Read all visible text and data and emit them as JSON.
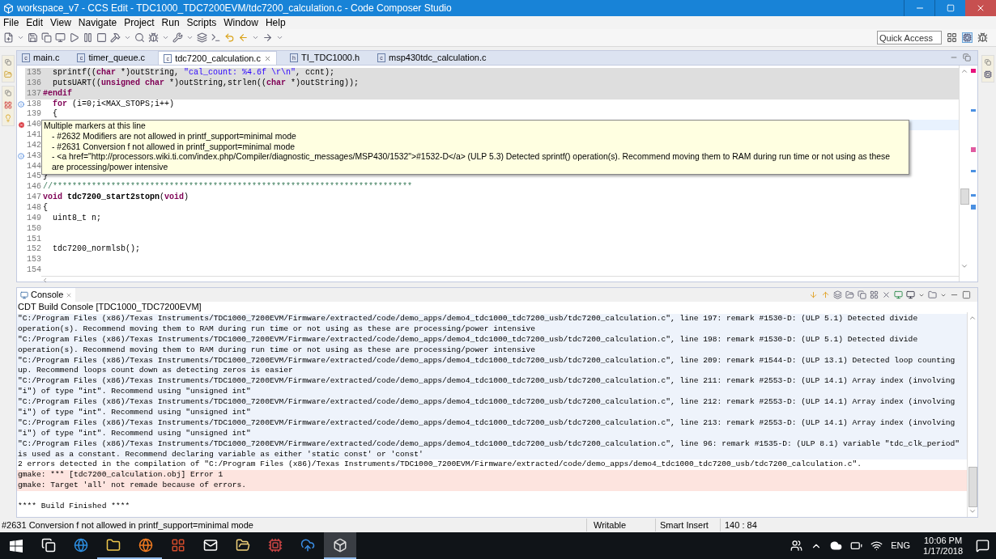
{
  "window": {
    "title": "workspace_v7 - CCS Edit - TDC1000_TDC7200EVM/tdc7200_calculation.c - Code Composer Studio"
  },
  "menu": [
    "File",
    "Edit",
    "View",
    "Navigate",
    "Project",
    "Run",
    "Scripts",
    "Window",
    "Help"
  ],
  "quick_access": {
    "placeholder": "Quick Access"
  },
  "editor_tabs": [
    {
      "label": "main.c",
      "type": "c",
      "selected": false
    },
    {
      "label": "timer_queue.c",
      "type": "c",
      "selected": false
    },
    {
      "label": "tdc7200_calculation.c",
      "type": "c",
      "selected": true
    },
    {
      "label": "TI_TDC1000.h",
      "type": "h",
      "selected": false
    },
    {
      "label": "msp430tdc_calculation.c",
      "type": "c",
      "selected": false
    }
  ],
  "editor": {
    "lines": [
      {
        "number": "135",
        "kind": "plain",
        "inactive": true,
        "current": false,
        "tokens": [
          {
            "kind": "plain",
            "text": "  sprintf(("
          },
          {
            "kind": "keyword",
            "text": "char"
          },
          {
            "kind": "plain",
            "text": " *)outString, "
          },
          {
            "kind": "string",
            "text": "\"cal_count: %4.6f \\r\\n\""
          },
          {
            "kind": "plain",
            "text": ", ccnt);"
          }
        ]
      },
      {
        "number": "136",
        "kind": "plain",
        "inactive": true,
        "current": false,
        "tokens": [
          {
            "kind": "plain",
            "text": "  putsUART(("
          },
          {
            "kind": "keyword",
            "text": "unsigned char"
          },
          {
            "kind": "plain",
            "text": " *)outString,strlen(("
          },
          {
            "kind": "keyword",
            "text": "char"
          },
          {
            "kind": "plain",
            "text": " *)outString));"
          }
        ]
      },
      {
        "number": "137",
        "kind": "plain",
        "inactive": true,
        "current": false,
        "tokens": [
          {
            "kind": "keyword",
            "text": "#endif"
          }
        ]
      },
      {
        "number": "138",
        "kind": "info",
        "inactive": false,
        "current": false,
        "tokens": [
          {
            "kind": "keyword",
            "text": "  for"
          },
          {
            "kind": "plain",
            "text": " (i=0;i<MAX_STOPS;i++)"
          }
        ]
      },
      {
        "number": "139",
        "kind": "plain",
        "inactive": false,
        "current": false,
        "tokens": [
          {
            "kind": "plain",
            "text": "  {"
          }
        ]
      },
      {
        "number": "140",
        "kind": "error",
        "inactive": false,
        "current": true
      },
      {
        "number": "141",
        "kind": "plain",
        "inactive": false,
        "current": false
      },
      {
        "number": "142",
        "kind": "plain",
        "inactive": false,
        "current": false
      },
      {
        "number": "143",
        "kind": "info",
        "inactive": false,
        "current": false
      },
      {
        "number": "144",
        "kind": "plain",
        "inactive": false,
        "current": false
      },
      {
        "number": "145",
        "kind": "plain",
        "inactive": false,
        "current": false,
        "tokens": [
          {
            "kind": "plain",
            "text": "}"
          }
        ]
      },
      {
        "number": "146",
        "kind": "plain",
        "inactive": false,
        "current": false,
        "tokens": [
          {
            "kind": "comment",
            "text": "//**************************************************************************"
          }
        ]
      },
      {
        "number": "147",
        "kind": "plain",
        "inactive": false,
        "current": false,
        "tokens": [
          {
            "kind": "keyword",
            "text": "void"
          },
          {
            "kind": "function",
            "text": " tdc7200_start2stopn"
          },
          {
            "kind": "plain",
            "text": "("
          },
          {
            "kind": "keyword",
            "text": "void"
          },
          {
            "kind": "plain",
            "text": ")"
          }
        ]
      },
      {
        "number": "148",
        "kind": "plain",
        "inactive": false,
        "current": false,
        "tokens": [
          {
            "kind": "plain",
            "text": "{"
          }
        ]
      },
      {
        "number": "149",
        "kind": "plain",
        "inactive": false,
        "current": false,
        "tokens": [
          {
            "kind": "plain",
            "text": "  uint8_t n;"
          }
        ]
      },
      {
        "number": "150",
        "kind": "plain",
        "inactive": false,
        "current": false
      },
      {
        "number": "151",
        "kind": "plain",
        "inactive": false,
        "current": false
      },
      {
        "number": "152",
        "kind": "plain",
        "inactive": false,
        "current": false,
        "tokens": [
          {
            "kind": "plain",
            "text": "  tdc7200_normlsb();"
          }
        ]
      },
      {
        "number": "153",
        "kind": "plain",
        "inactive": false,
        "current": false
      },
      {
        "number": "154",
        "kind": "plain",
        "inactive": false,
        "current": false
      }
    ],
    "tooltip": {
      "title": "Multiple markers at this line",
      "items": [
        "- #2632 Modifiers are not allowed in printf_support=minimal mode",
        "- #2631 Conversion f not allowed in printf_support=minimal mode",
        "- <a href=\"http://processors.wiki.ti.com/index.php/Compiler/diagnostic_messages/MSP430/1532\">#1532-D</a> (ULP 5.3) Detected sprintf() operation(s). Recommend moving them to RAM during run time or not using as these are processing/power intensive"
      ]
    }
  },
  "console": {
    "tab": "Console",
    "subtitle": "CDT Build Console [TDC1000_TDC7200EVM]",
    "lines": [
      {
        "kind": "remark",
        "text": "\"C:/Program Files (x86)/Texas Instruments/TDC1000_7200EVM/Firmware/extracted/code/demo_apps/demo4_tdc1000_tdc7200_usb/tdc7200_calculation.c\", line 197: remark #1530-D: (ULP 5.1) Detected divide"
      },
      {
        "kind": "remark",
        "text": "operation(s). Recommend moving them to RAM during run time or not using as these are processing/power intensive"
      },
      {
        "kind": "remark",
        "text": "\"C:/Program Files (x86)/Texas Instruments/TDC1000_7200EVM/Firmware/extracted/code/demo_apps/demo4_tdc1000_tdc7200_usb/tdc7200_calculation.c\", line 198: remark #1530-D: (ULP 5.1) Detected divide"
      },
      {
        "kind": "remark",
        "text": "operation(s). Recommend moving them to RAM during run time or not using as these are processing/power intensive"
      },
      {
        "kind": "remark",
        "text": "\"C:/Program Files (x86)/Texas Instruments/TDC1000_7200EVM/Firmware/extracted/code/demo_apps/demo4_tdc1000_tdc7200_usb/tdc7200_calculation.c\", line 209: remark #1544-D: (ULP 13.1) Detected loop counting"
      },
      {
        "kind": "remark",
        "text": "up. Recommend loops count down as detecting zeros is easier"
      },
      {
        "kind": "remark",
        "text": "\"C:/Program Files (x86)/Texas Instruments/TDC1000_7200EVM/Firmware/extracted/code/demo_apps/demo4_tdc1000_tdc7200_usb/tdc7200_calculation.c\", line 211: remark #2553-D: (ULP 14.1) Array index (involving"
      },
      {
        "kind": "remark",
        "text": "\"i\") of type \"int\". Recommend using \"unsigned int\""
      },
      {
        "kind": "remark",
        "text": "\"C:/Program Files (x86)/Texas Instruments/TDC1000_7200EVM/Firmware/extracted/code/demo_apps/demo4_tdc1000_tdc7200_usb/tdc7200_calculation.c\", line 212: remark #2553-D: (ULP 14.1) Array index (involving"
      },
      {
        "kind": "remark",
        "text": "\"i\") of type \"int\". Recommend using \"unsigned int\""
      },
      {
        "kind": "remark",
        "text": "\"C:/Program Files (x86)/Texas Instruments/TDC1000_7200EVM/Firmware/extracted/code/demo_apps/demo4_tdc1000_tdc7200_usb/tdc7200_calculation.c\", line 213: remark #2553-D: (ULP 14.1) Array index (involving"
      },
      {
        "kind": "remark",
        "text": "\"i\") of type \"int\". Recommend using \"unsigned int\""
      },
      {
        "kind": "remark",
        "text": "\"C:/Program Files (x86)/Texas Instruments/TDC1000_7200EVM/Firmware/extracted/code/demo_apps/demo4_tdc1000_tdc7200_usb/tdc7200_calculation.c\", line 96: remark #1535-D: (ULP 8.1) variable \"tdc_clk_period\""
      },
      {
        "kind": "remark",
        "text": "is used as a constant. Recommend declaring variable as either 'static const' or 'const'"
      },
      {
        "kind": "plain",
        "text": "2 errors detected in the compilation of \"C:/Program Files (x86)/Texas Instruments/TDC1000_7200EVM/Firmware/extracted/code/demo_apps/demo4_tdc1000_tdc7200_usb/tdc7200_calculation.c\"."
      },
      {
        "kind": "error",
        "text": "gmake: *** [tdc7200_calculation.obj] Error 1"
      },
      {
        "kind": "error",
        "text": "gmake: Target 'all' not remade because of errors."
      },
      {
        "kind": "blank"
      },
      {
        "kind": "plain",
        "text": "**** Build Finished ****"
      }
    ]
  },
  "status_bar": {
    "message": "#2631 Conversion f not allowed in printf_support=minimal mode",
    "mode": "Writable",
    "insert": "Smart Insert",
    "position": "140 : 84"
  },
  "taskbar": {
    "apps": [
      {
        "kind": "task-view",
        "running": false,
        "active": false
      },
      {
        "kind": "edge",
        "running": false,
        "active": false
      },
      {
        "kind": "explorer",
        "running": true,
        "active": false
      },
      {
        "kind": "firefox",
        "running": true,
        "active": false
      },
      {
        "kind": "tiles",
        "running": false,
        "active": false
      },
      {
        "kind": "mail",
        "running": false,
        "active": false
      },
      {
        "kind": "folder",
        "running": false,
        "active": false
      },
      {
        "kind": "chip",
        "running": false,
        "active": false
      },
      {
        "kind": "cloud",
        "running": false,
        "active": false
      },
      {
        "kind": "cube",
        "running": true,
        "active": true
      }
    ],
    "language": "ENG",
    "time": "10:06 PM",
    "date": "1/17/2018"
  }
}
